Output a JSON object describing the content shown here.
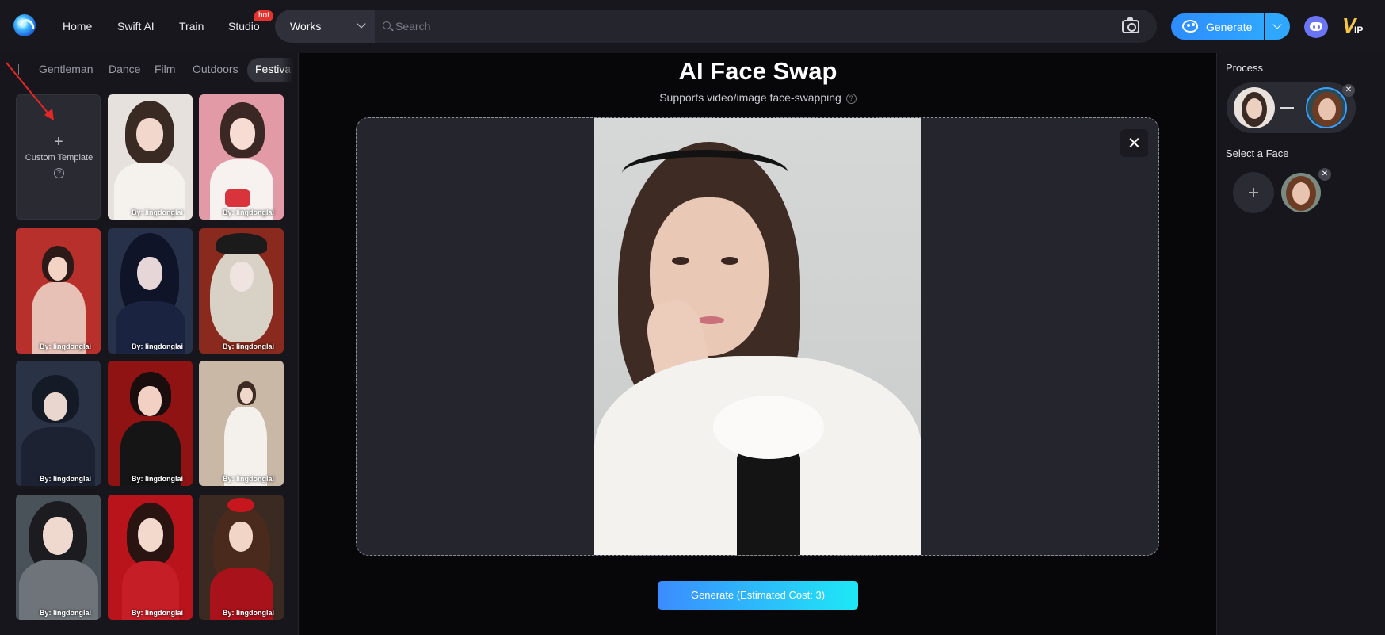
{
  "nav": {
    "items": [
      {
        "label": "Home"
      },
      {
        "label": "Swift AI"
      },
      {
        "label": "Train"
      },
      {
        "label": "Studio"
      }
    ],
    "hot_badge": "hot",
    "search": {
      "scope": "Works",
      "placeholder": "Search"
    },
    "generate_label": "Generate",
    "icons": [
      "logo-icon",
      "search-icon",
      "camera-icon",
      "palette-icon",
      "chevron-down-icon",
      "discord-icon",
      "vip-icon"
    ],
    "vip_badge": {
      "v": "V",
      "ip": "IP"
    }
  },
  "left": {
    "categories": [
      {
        "label": "Gentleman"
      },
      {
        "label": "Dance"
      },
      {
        "label": "Film"
      },
      {
        "label": "Outdoors"
      },
      {
        "label": "Festival"
      }
    ],
    "custom_template": {
      "label": "Custom Template",
      "help": "?"
    },
    "tiles": [
      {
        "credit": "By: lingdonglai"
      },
      {
        "credit": "By: lingdonglai"
      },
      {
        "credit": "By: lingdonglai"
      },
      {
        "credit": "By: lingdonglai"
      },
      {
        "credit": "By: lingdonglai"
      },
      {
        "credit": "By: lingdonglai"
      },
      {
        "credit": "By: lingdonglai"
      },
      {
        "credit": "By: lingdonglai"
      },
      {
        "credit": "By: lingdonglai"
      },
      {
        "credit": "By: lingdonglai"
      },
      {
        "credit": "By: lingdonglai"
      }
    ]
  },
  "main": {
    "title": "AI Face Swap",
    "subtitle": "Supports video/image face-swapping",
    "help": "?",
    "generate_button": "Generate (Estimated Cost: 3)"
  },
  "right": {
    "process_label": "Process",
    "select_face_label": "Select a Face",
    "remove_symbol": "✕"
  },
  "colors": {
    "accent_blue": "#2e8cff",
    "accent_cyan": "#1ee8f5",
    "hot_red": "#e5322d",
    "vip_gold": "#f6c64a"
  }
}
